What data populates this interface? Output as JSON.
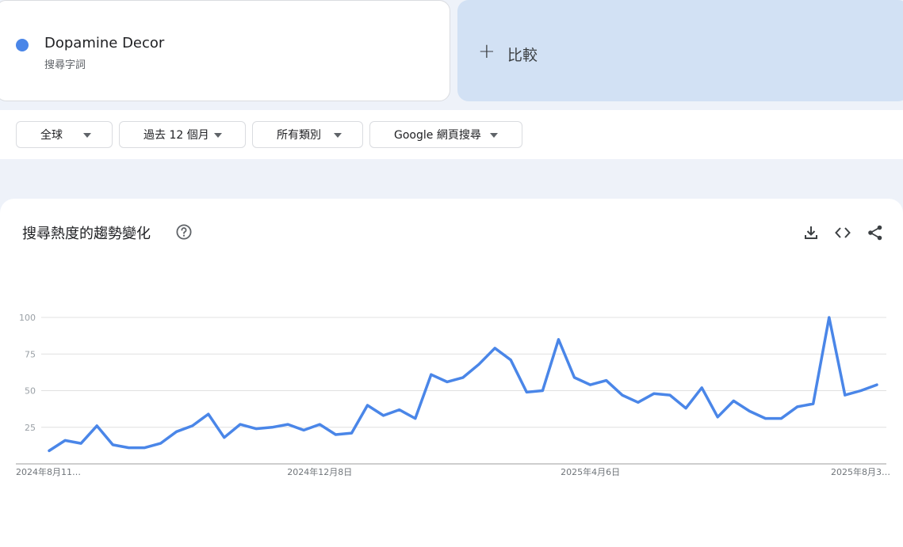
{
  "term": {
    "name": "Dopamine Decor",
    "type_label": "搜尋字詞",
    "color": "#4a86e8"
  },
  "compare": {
    "plus": "+",
    "label": "比較"
  },
  "filters": {
    "region": "全球",
    "time": "過去 12 個月",
    "category": "所有類別",
    "search_type": "Google 網頁搜尋"
  },
  "card": {
    "title": "搜尋熱度的趨勢變化",
    "help_icon": "help-circle-icon",
    "actions": [
      "download-icon",
      "embed-code-icon",
      "share-icon"
    ]
  },
  "chart_data": {
    "type": "line",
    "title": "",
    "xlabel": "",
    "ylabel": "",
    "ylim": [
      0,
      100
    ],
    "yticks": [
      25,
      50,
      75,
      100
    ],
    "grid": true,
    "xtick_labels": [
      "2024年8月11…",
      "2024年12月8日",
      "2025年4月6日",
      "2025年8月3…"
    ],
    "xtick_indices": [
      0,
      17,
      34,
      51
    ],
    "series": [
      {
        "color": "#4a86e8",
        "values": [
          9,
          16,
          14,
          26,
          13,
          11,
          11,
          14,
          22,
          26,
          34,
          18,
          27,
          24,
          25,
          27,
          23,
          27,
          20,
          21,
          40,
          33,
          37,
          31,
          61,
          56,
          59,
          68,
          79,
          71,
          49,
          50,
          85,
          59,
          54,
          57,
          47,
          42,
          48,
          47,
          38,
          52,
          32,
          43,
          36,
          31,
          31,
          39,
          41,
          100,
          47,
          50,
          54
        ]
      }
    ]
  }
}
